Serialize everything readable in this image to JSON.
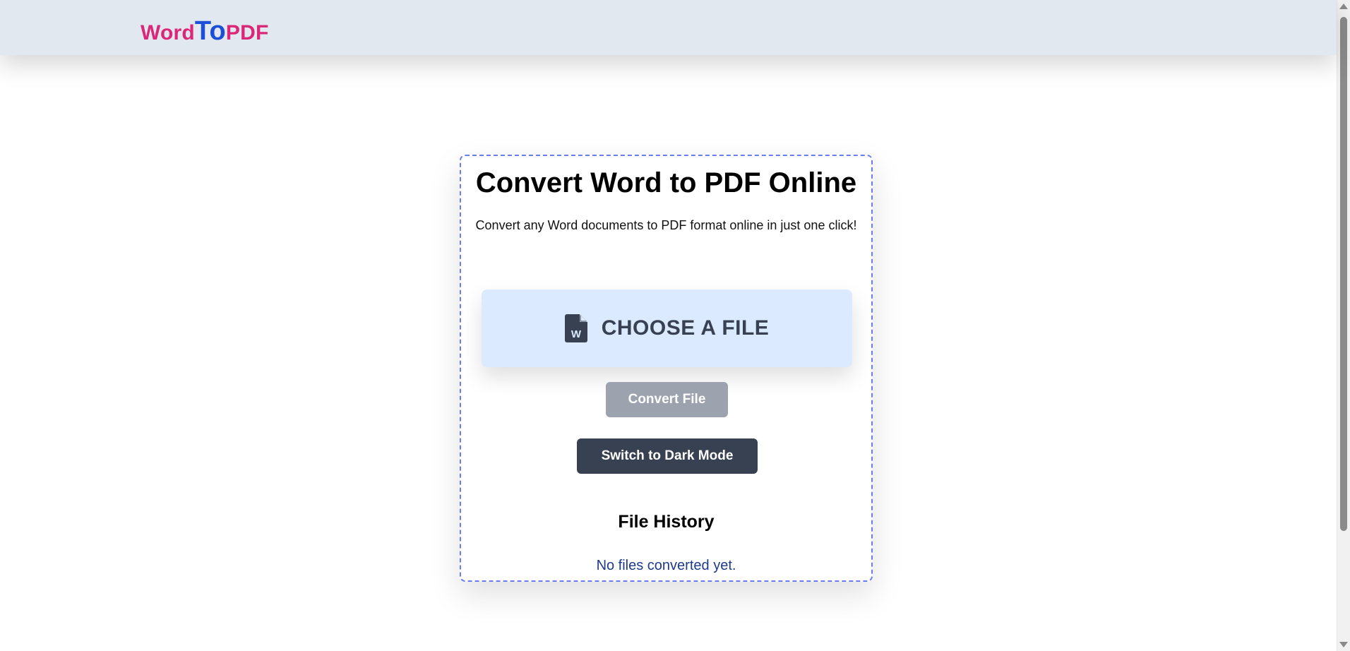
{
  "navbar": {
    "logo": {
      "part1": "Word",
      "part2": "To",
      "part3": "PDF"
    }
  },
  "card": {
    "title": "Convert Word to PDF Online",
    "subtitle": "Convert any Word documents to PDF format online in just one click!",
    "choose_file": {
      "label": "CHOOSE A FILE",
      "icon": "word-file-icon"
    },
    "convert_button": "Convert File",
    "dark_mode_button": "Switch to Dark Mode",
    "history": {
      "title": "File History",
      "empty_message": "No files converted yet."
    }
  },
  "colors": {
    "navbar_bg": "#e2e8f0",
    "logo_pink": "#db2777",
    "logo_blue": "#1d4ed8",
    "card_border": "#6b7cf0",
    "choose_bg": "#dbeafe",
    "convert_disabled": "#9ca3af",
    "dark_button": "#374151",
    "history_text": "#1e3a8a"
  }
}
